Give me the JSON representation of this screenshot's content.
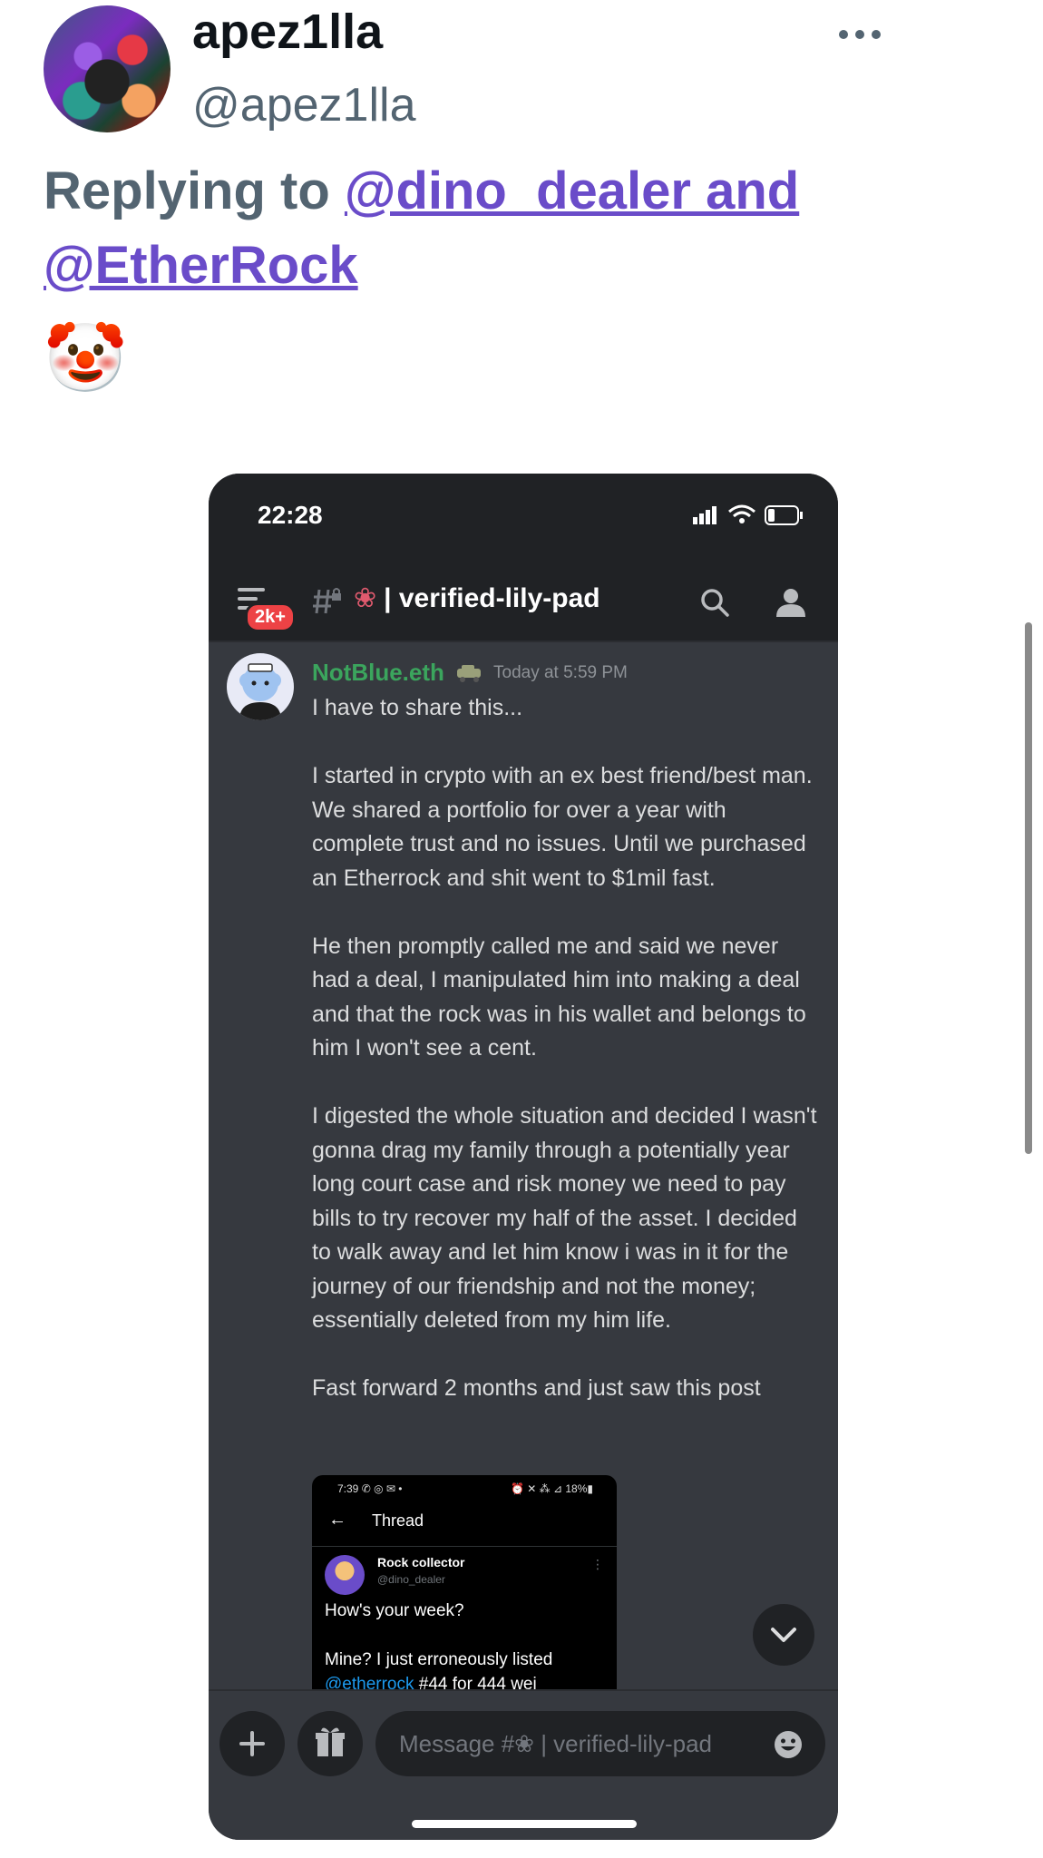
{
  "tweet": {
    "display_name": "apez1lla",
    "handle": "@apez1lla",
    "reply_prefix": "Replying to",
    "reply_mention_1": "@dino_dealer and",
    "reply_mention_2": "@EtherRock",
    "text_emoji": "🤡"
  },
  "phone": {
    "time": "22:28",
    "badge": "2k+",
    "channel_name": "| verified-lily-pad",
    "channel_emoji": "❀",
    "message": {
      "author": "NotBlue.eth",
      "timestamp": "Today at 5:59 PM",
      "paragraphs": [
        "I have to share this...",
        "I started in crypto with an ex best friend/best man. We shared a portfolio for over a year with complete trust and no issues. Until we purchased an Etherrock and shit went to $1mil fast.",
        "He then promptly called me and said we never had a deal, I manipulated him into making a deal and that the rock was in his wallet and belongs to him I won't see a cent.",
        "I digested the whole situation and decided I wasn't gonna drag my family through a potentially year long court case and risk money we need to pay bills to try recover my half of the asset. I decided to walk away and let him know i was in it for the journey of our friendship and not the money; essentially deleted from my him life.",
        "Fast forward 2 months and just saw this post"
      ]
    },
    "embed": {
      "status_left": "7:39 ✆ ◎ ✉ •",
      "status_right": "⏰ ✕ ⁂ ⊿ 18%▮",
      "title": "Thread",
      "name": "Rock collector",
      "handle": "@dino_dealer",
      "line1": "How's your week?",
      "line2": "Mine? I just erroneously listed",
      "link": "@etherrock",
      "line3": " #44 for 444 wei"
    },
    "composer_placeholder": "Message #❀ | verified-lily-pad"
  }
}
